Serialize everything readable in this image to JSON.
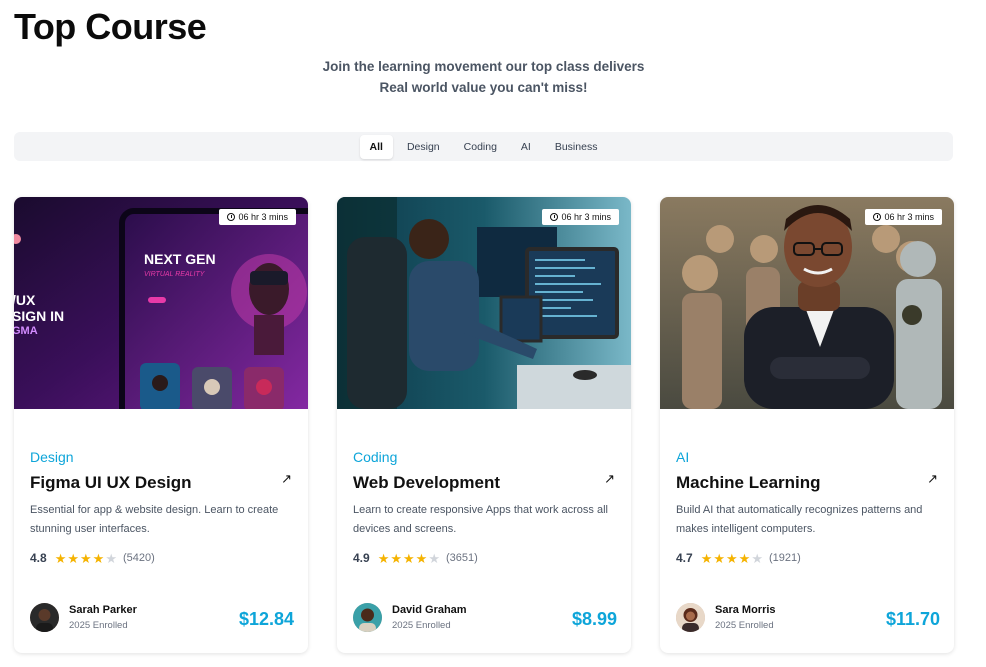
{
  "header": {
    "title": "Top Course",
    "subtitle_line1": "Join the learning movement our top class delivers",
    "subtitle_line2": "Real world value you can't miss!"
  },
  "filters": {
    "tabs": [
      {
        "label": "All",
        "active": true
      },
      {
        "label": "Design",
        "active": false
      },
      {
        "label": "Coding",
        "active": false
      },
      {
        "label": "AI",
        "active": false
      },
      {
        "label": "Business",
        "active": false
      }
    ]
  },
  "accent_color": "#0ea5d9",
  "star_color": "#f5b301",
  "courses": [
    {
      "duration": "06 hr 3 mins",
      "category": "Design",
      "title": "Figma UI UX Design",
      "description": "Essential for app & website design. Learn to create stunning user interfaces.",
      "rating": "4.8",
      "stars_filled": 4,
      "reviews": "(5420)",
      "author": "Sarah Parker",
      "enrolled": "2025 Enrolled",
      "price": "$12.84",
      "image_text_1": "NEXT GEN",
      "image_text_2": "VIRTUAL REALITY",
      "image_text_3": "/UX",
      "image_text_4": "SIGN IN",
      "image_text_5": "GMA"
    },
    {
      "duration": "06 hr 3 mins",
      "category": "Coding",
      "title": "Web Development",
      "description": "Learn to create responsive Apps that work across all devices and screens.",
      "rating": "4.9",
      "stars_filled": 4,
      "reviews": "(3651)",
      "author": "David Graham",
      "enrolled": "2025 Enrolled",
      "price": "$8.99"
    },
    {
      "duration": "06 hr 3 mins",
      "category": "AI",
      "title": "Machine Learning",
      "description": "Build AI that automatically recognizes patterns and makes intelligent computers.",
      "rating": "4.7",
      "stars_filled": 4,
      "reviews": "(1921)",
      "author": "Sara Morris",
      "enrolled": "2025 Enrolled",
      "price": "$11.70"
    }
  ]
}
